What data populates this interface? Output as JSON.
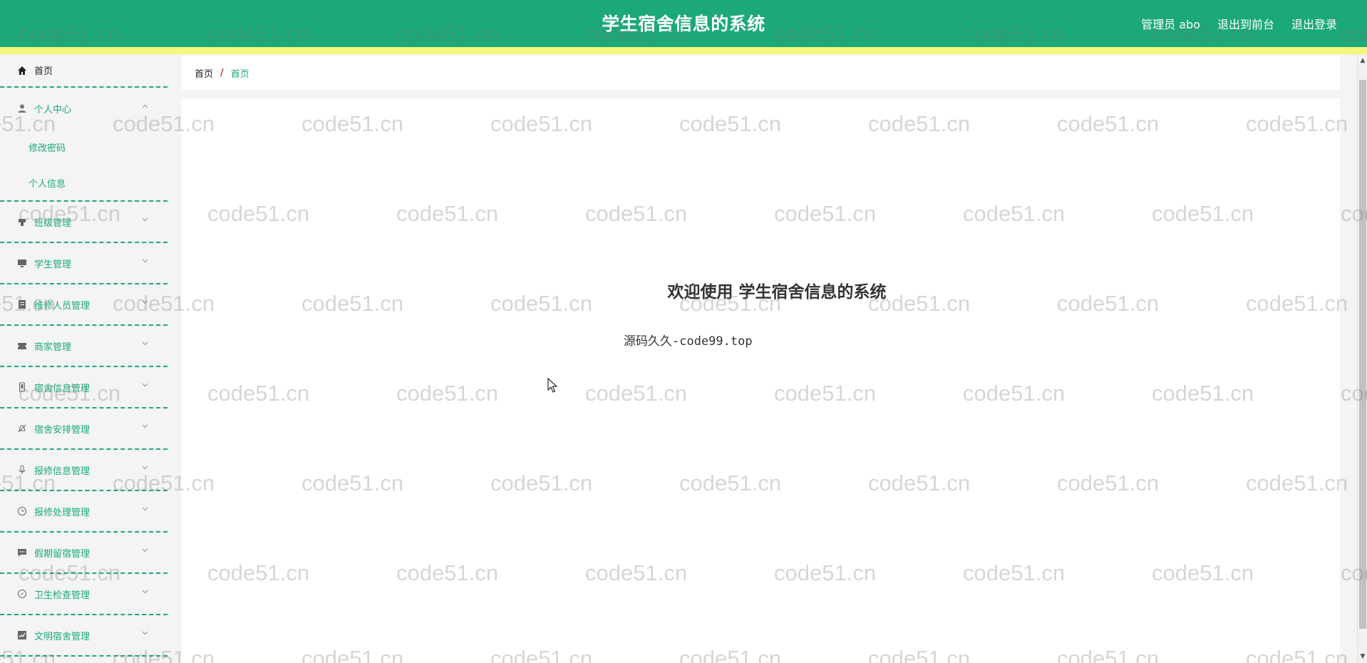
{
  "header": {
    "title": "学生宿舍信息的系统",
    "user_label": "管理员 abo",
    "exit_frontend": "退出到前台",
    "logout": "退出登录"
  },
  "sidebar": {
    "home": "首页",
    "personal_center": {
      "label": "个人中心",
      "children": [
        "修改密码",
        "个人信息"
      ]
    },
    "items": [
      {
        "label": "班级管理",
        "icon": "clipboard-icon"
      },
      {
        "label": "学生管理",
        "icon": "monitor-icon"
      },
      {
        "label": "维修人员管理",
        "icon": "document-icon"
      },
      {
        "label": "商家管理",
        "icon": "ticket-icon"
      },
      {
        "label": "宿舍信息管理",
        "icon": "phone-icon"
      },
      {
        "label": "宿舍安排管理",
        "icon": "bell-off-icon"
      },
      {
        "label": "报修信息管理",
        "icon": "microphone-icon"
      },
      {
        "label": "报修处理管理",
        "icon": "clock-icon"
      },
      {
        "label": "假期留宿管理",
        "icon": "chat-icon"
      },
      {
        "label": "卫生检查管理",
        "icon": "compass-icon"
      },
      {
        "label": "文明宿舍管理",
        "icon": "chart-icon"
      }
    ]
  },
  "breadcrumb": {
    "home": "首页",
    "separator": "/",
    "current": "首页"
  },
  "main": {
    "welcome": "欢迎使用 学生宿舍信息的系统",
    "source": "源码久久-code99.top"
  },
  "watermark": "code51.cn",
  "colors": {
    "primary": "#1ba87a",
    "header_strip": "#f6f67a",
    "breadcrumb_separator": "#c0392b"
  }
}
